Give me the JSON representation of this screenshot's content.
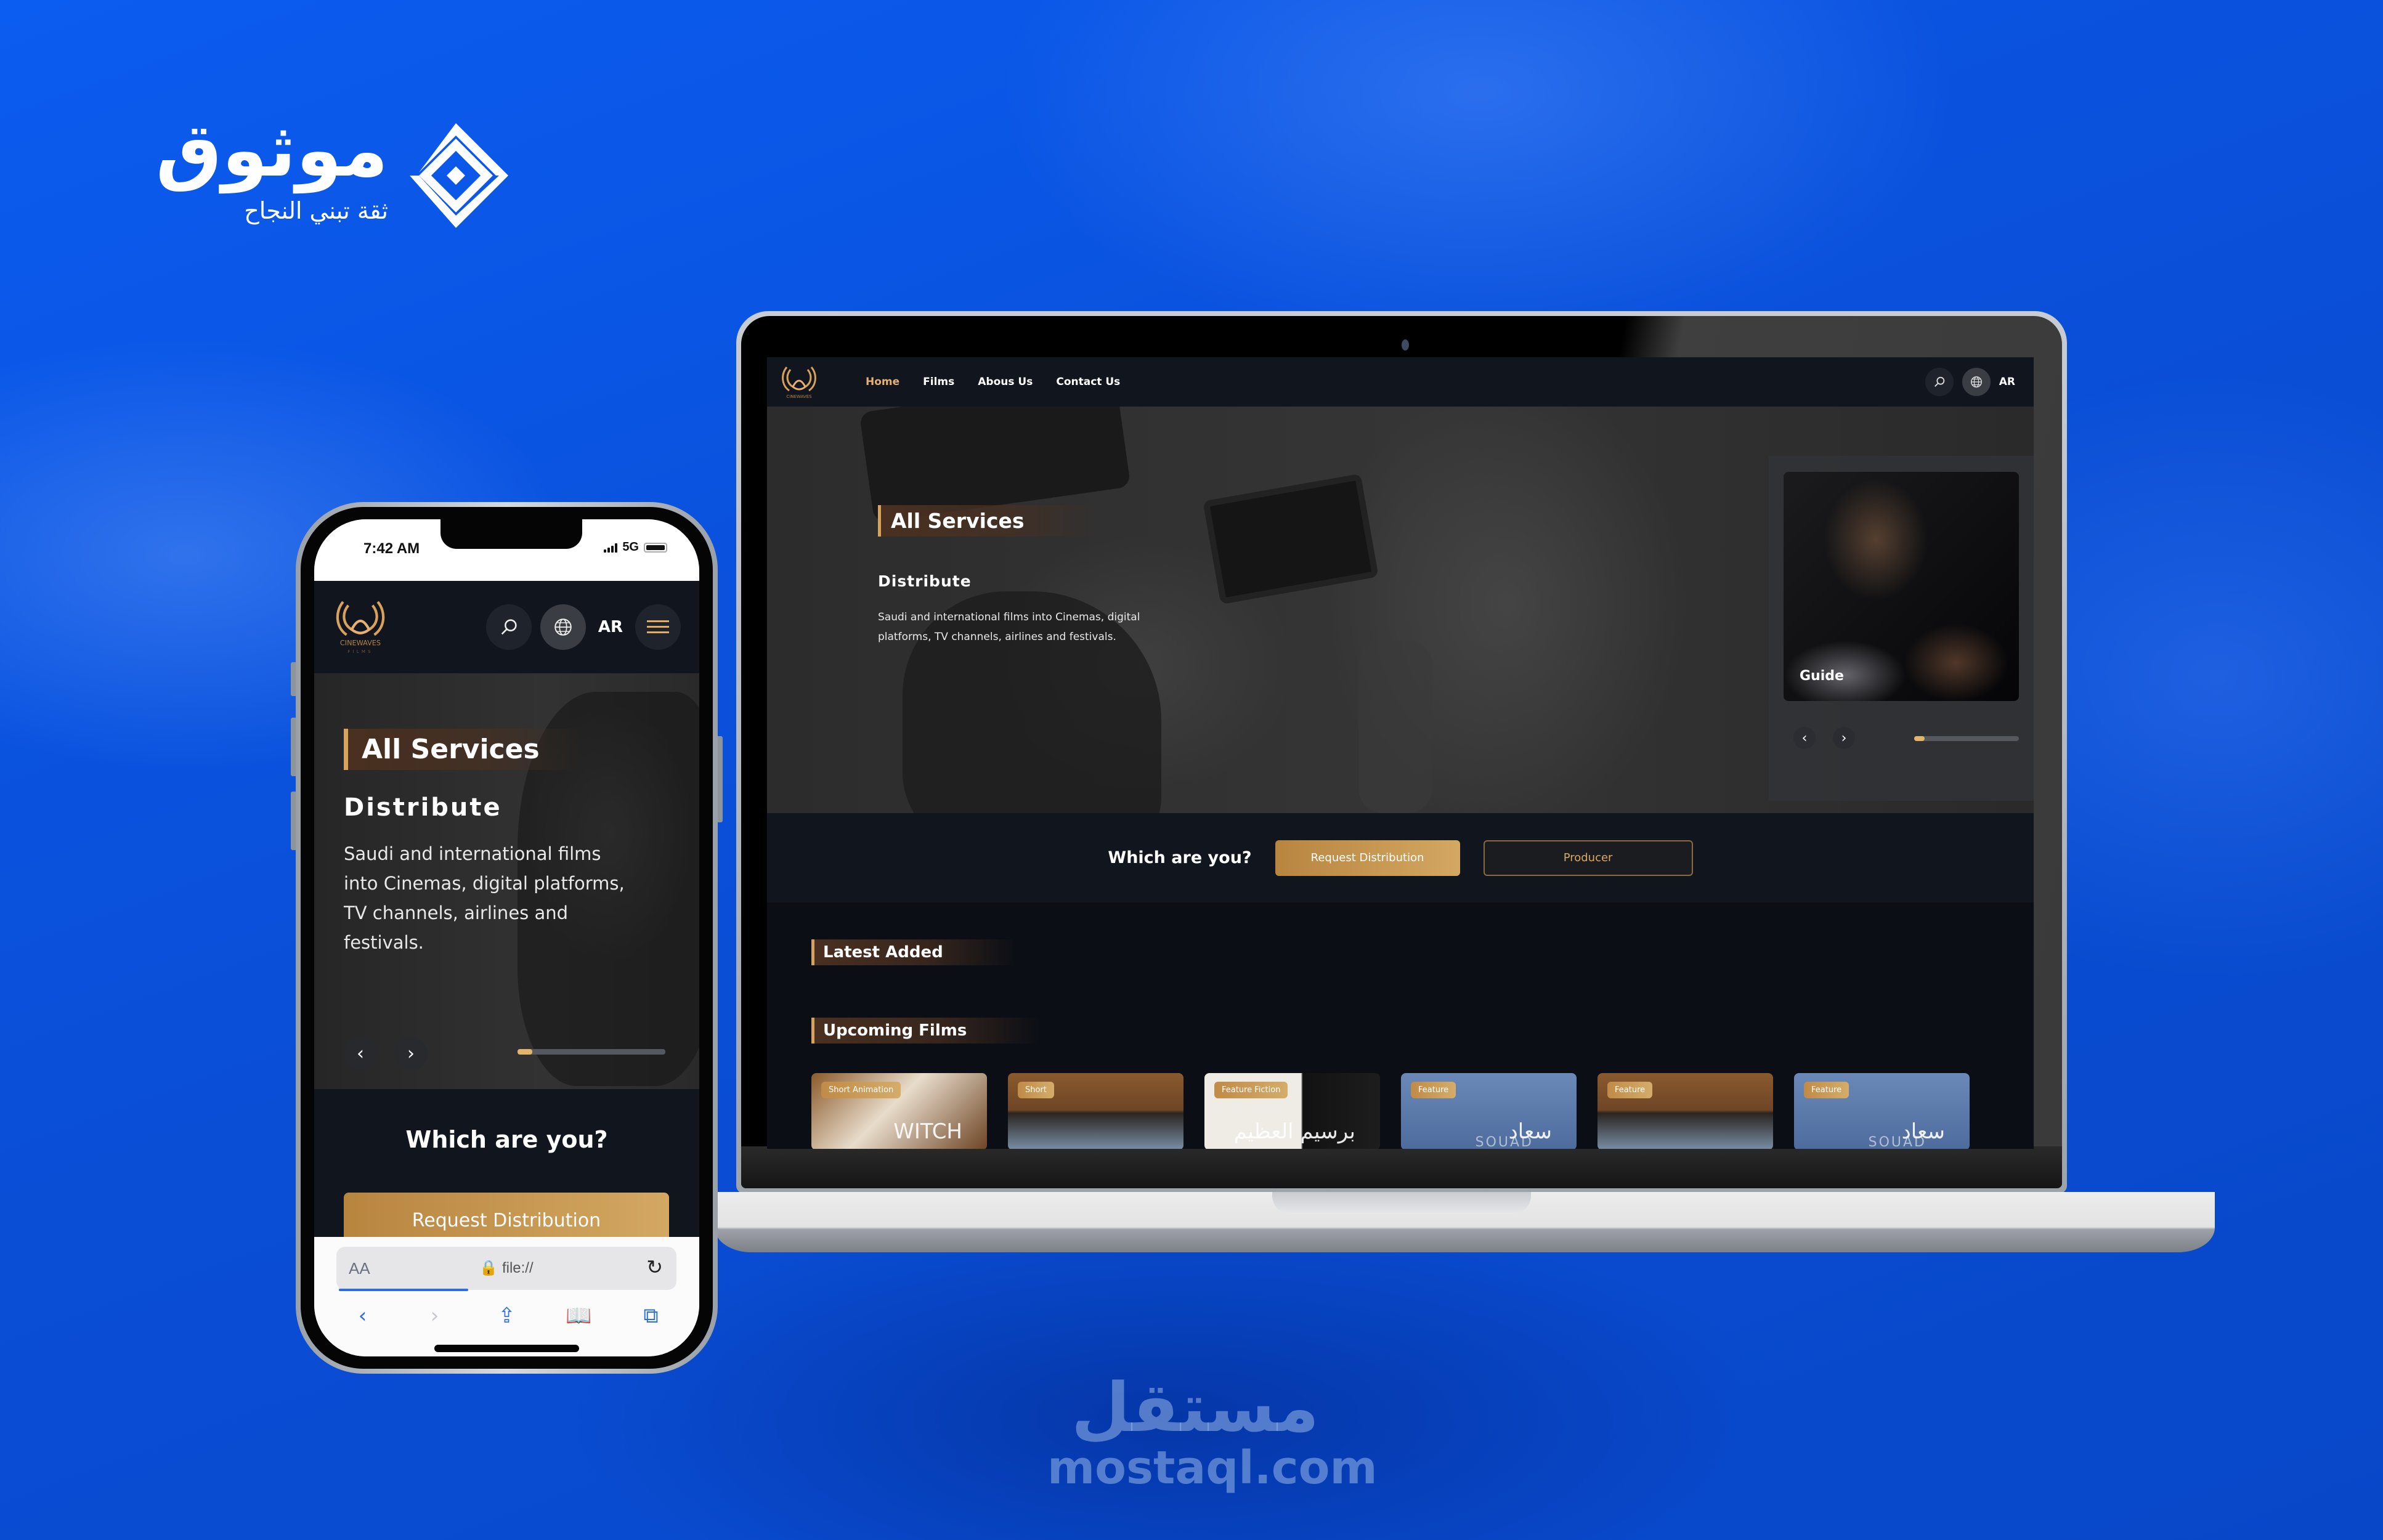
{
  "brand": {
    "name_ar": "موثوق",
    "tagline_ar": "ثقة تبني النجاح",
    "icon": "mowthooq-diamond-logo-icon"
  },
  "colors": {
    "background_blue": "#0a55e6",
    "gold_accent": "#d5a35d",
    "nav_active": "#e6b073",
    "dark_surface": "#11151d"
  },
  "site": {
    "logo_text": "CINEWAVES",
    "logo_subtext": "FILMS",
    "nav": {
      "links": [
        {
          "label": "Home",
          "active": true
        },
        {
          "label": "Films",
          "active": false
        },
        {
          "label": "Abous Us",
          "active": false
        },
        {
          "label": "Contact Us",
          "active": false
        }
      ],
      "search_icon": "search-icon",
      "language_icon": "globe-icon",
      "language_label": "AR",
      "menu_icon": "hamburger-menu-icon"
    },
    "hero": {
      "section_title": "All Services",
      "subtitle": "Distribute",
      "description": "Saudi and international films into Cinemas, digital platforms, TV channels, airlines and festivals.",
      "slider_progress": 0.1,
      "prev_label": "‹",
      "next_label": "›",
      "side_card_label": "Guide"
    },
    "which": {
      "label": "Which are you?",
      "primary_button": "Request Distribution",
      "secondary_button": "Producer"
    },
    "sections": {
      "latest": "Latest Added",
      "upcoming": "Upcoming Films"
    },
    "films": [
      {
        "badge": "Short Animation",
        "poster_text": "WITCH",
        "style": "witch"
      },
      {
        "badge": "Short",
        "poster_text": "",
        "style": "short"
      },
      {
        "badge": "Feature Fiction",
        "poster_text": "برسيم العظيم",
        "style": "feature-fic"
      },
      {
        "badge": "Feature",
        "poster_text": "سعاد",
        "poster_sub": "SOUAD",
        "style": "souad"
      },
      {
        "badge": "Feature",
        "poster_text": "",
        "style": "short"
      },
      {
        "badge": "Feature",
        "poster_text": "سعاد",
        "poster_sub": "SOUAD",
        "style": "souad"
      }
    ]
  },
  "phone": {
    "time": "7:42 AM",
    "network": "5G",
    "browser": {
      "text_size_label": "AA",
      "url": "file://",
      "load_progress": 0.38,
      "toolbar": [
        "back",
        "forward",
        "share",
        "bookmarks",
        "tabs"
      ]
    }
  },
  "watermark": {
    "name_ar": "مستقل",
    "domain": "mostaql.com"
  }
}
